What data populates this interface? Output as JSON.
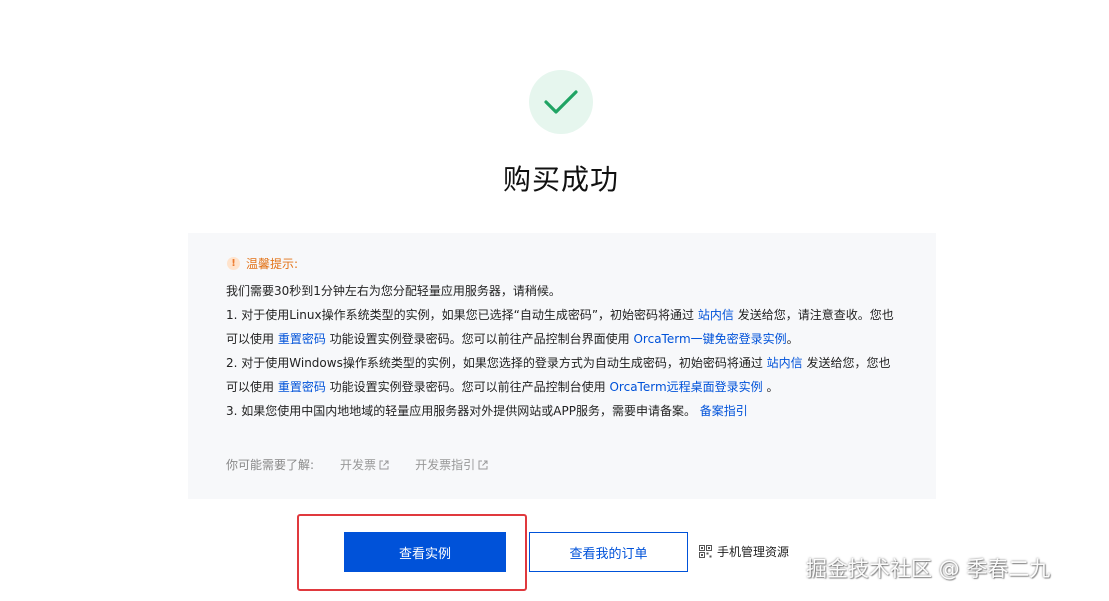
{
  "result": {
    "icon": "check-icon",
    "title": "购买成功"
  },
  "notice": {
    "heading": "温馨提示:",
    "intro": "我们需要30秒到1分钟左右为您分配轻量应用服务器，请稍候。",
    "item1": {
      "p1": "1. 对于使用Linux操作系统类型的实例，如果您已选择“自动生成密码”，初始密码将通过 ",
      "link1": "站内信",
      "p2": " 发送给您，请注意查收。您也可以使用 ",
      "link2": "重置密码",
      "p3": " 功能设置实例登录密码。您可以前往产品控制台界面使用 ",
      "link3": "OrcaTerm一键免密登录实例",
      "p4": "。"
    },
    "item2": {
      "p1": "2. 对于使用Windows操作系统类型的实例，如果您选择的登录方式为自动生成密码，初始密码将通过 ",
      "link1": "站内信",
      "p2": " 发送给您，您也可以使用 ",
      "link2": "重置密码",
      "p3": " 功能设置实例登录密码。您可以前往产品控制台使用 ",
      "link3": "OrcaTerm远程桌面登录实例",
      "p4": " 。"
    },
    "item3": {
      "p1": "3. 如果您使用中国内地地域的轻量应用服务器对外提供网站或APP服务，需要申请备案。 ",
      "link1": "备案指引"
    },
    "maybe_label": "你可能需要了解:",
    "maybe_links": [
      "开发票",
      "开发票指引"
    ]
  },
  "actions": {
    "primary": "查看实例",
    "secondary": "查看我的订单",
    "mobile": "手机管理资源",
    "mobile_icon": "qr-code-icon"
  },
  "watermark": "掘金技术社区 @ 季春二九",
  "colors": {
    "primary": "#0052d9",
    "success": "#20a464",
    "warning": "#e37318",
    "highlight": "#e0393e"
  }
}
